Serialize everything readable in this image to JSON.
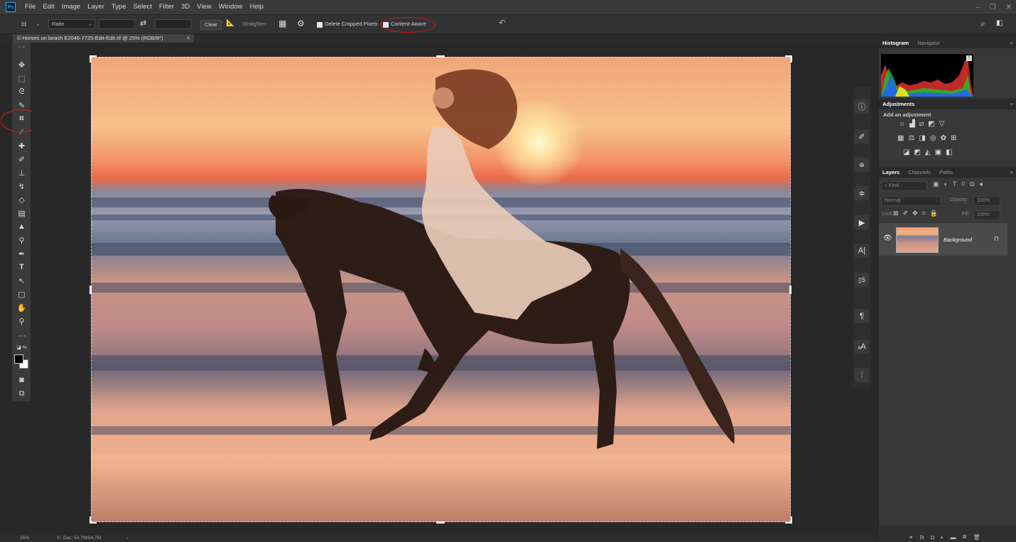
{
  "app": {
    "logo": "Ps",
    "menu": [
      "File",
      "Edit",
      "Image",
      "Layer",
      "Type",
      "Select",
      "Filter",
      "3D",
      "View",
      "Window",
      "Help"
    ]
  },
  "options": {
    "ratio": "Ratio",
    "clear": "Clear",
    "straighten": "Straighten",
    "delete_cropped": "Delete Cropped Pixels",
    "content_aware": "Content-Aware"
  },
  "document": {
    "tab_title": "© Horses on beach E2046-7725-Edit-Edit.tif @ 25% (RGB/8*)",
    "zoom": "25%",
    "doc_size": "Doc: 54.7M/54.7M"
  },
  "panels": {
    "histogram_tab": "Histogram",
    "navigator_tab": "Navigator",
    "adjustments_title": "Adjustments",
    "add_adjustment": "Add an adjustment",
    "layers_tab": "Layers",
    "channels_tab": "Channels",
    "paths_tab": "Paths",
    "kind": "Kind",
    "blend_mode": "Normal",
    "opacity_label": "Opacity:",
    "opacity_value": "100%",
    "lock_label": "Lock:",
    "fill_label": "Fill:",
    "fill_value": "100%",
    "layer_name": "Background"
  },
  "colors": {
    "accent": "#31a8ff",
    "annotation": "#e01818"
  }
}
